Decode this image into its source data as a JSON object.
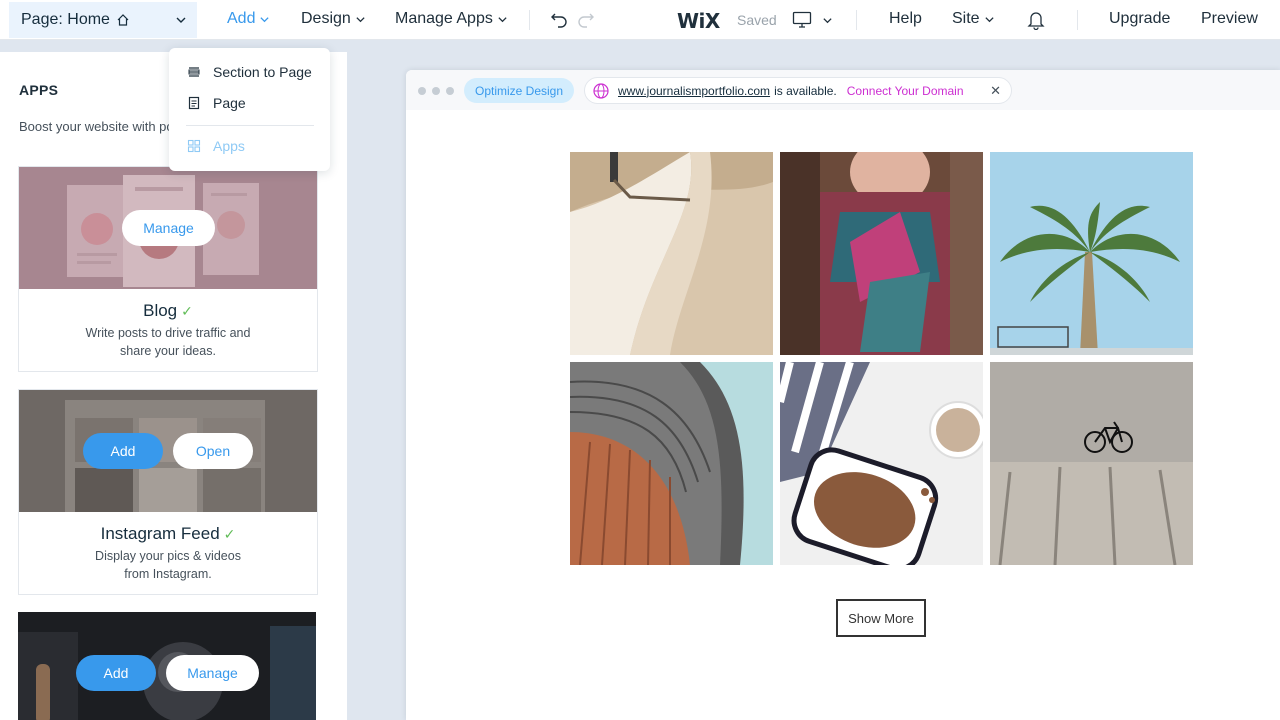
{
  "topbar": {
    "page_label": "Page: Home",
    "add": "Add",
    "design": "Design",
    "manage_apps": "Manage Apps",
    "logo": "WiX",
    "saved": "Saved",
    "help": "Help",
    "site": "Site",
    "upgrade": "Upgrade",
    "preview": "Preview"
  },
  "add_menu": {
    "items": [
      {
        "label": "Section to Page",
        "icon": "section-icon"
      },
      {
        "label": "Page",
        "icon": "page-icon"
      },
      {
        "label": "Apps",
        "icon": "apps-icon"
      }
    ]
  },
  "panel": {
    "title": "APPS",
    "description": "Boost your website with pov",
    "apps": [
      {
        "name": "Blog",
        "desc_line1": "Write posts to drive traffic and",
        "desc_line2": "share your ideas.",
        "buttons": [
          "Manage"
        ]
      },
      {
        "name": "Instagram Feed",
        "desc_line1": "Display your pics & videos",
        "desc_line2": "from Instagram.",
        "buttons": [
          "Add",
          "Open"
        ]
      },
      {
        "name": "",
        "buttons": [
          "Add",
          "Manage"
        ]
      }
    ]
  },
  "canvas": {
    "optimize": "Optimize Design",
    "domain_url": "www.journalismportfolio.com",
    "domain_available": "is available.",
    "connect_domain": "Connect Your Domain",
    "show_more": "Show More",
    "photos": [
      "beach",
      "woman-scarf",
      "palm-tree",
      "stadium",
      "coffee-snack",
      "bicycle"
    ]
  },
  "colors": {
    "accent": "#3899ec",
    "connect": "#cc2fd1",
    "check": "#60bc57"
  }
}
